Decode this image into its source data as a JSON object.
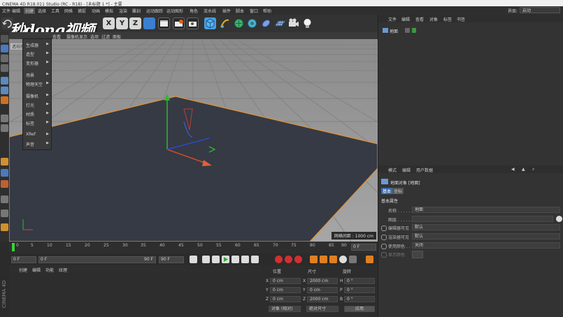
{
  "window": {
    "title": "CINEMA 4D R18.011 Studio (RC - R18) - [未标题 1 *] - 主要"
  },
  "menubar": {
    "items": [
      "文件",
      "编辑",
      "创建",
      "选择",
      "工具",
      "网格",
      "捕捉",
      "动画",
      "模拟",
      "渲染",
      "雕刻",
      "运动跟踪",
      "运动图形",
      "角色",
      "流水线",
      "插件",
      "脚本",
      "窗口",
      "帮助"
    ],
    "layout_label": "界面:",
    "layout_value": "启动"
  },
  "toolbar": {
    "axis_x": "X",
    "axis_y": "Y",
    "axis_z": "Z"
  },
  "watermark": {
    "text": "秒dong视频"
  },
  "viewport": {
    "menu": [
      "查看",
      "摄像机",
      "显示",
      "选项",
      "过滤",
      "面板"
    ],
    "perspective_label": "透视视图",
    "grid_spacing": "网格间距 : 1000 cm"
  },
  "create_menu": {
    "items": [
      {
        "label": "生成器",
        "arrow": true
      },
      {
        "label": "造型",
        "arrow": true
      },
      {
        "label": "变形器",
        "arrow": true
      },
      {
        "label": "场景",
        "arrow": true
      },
      {
        "label": "物理天空",
        "arrow": true
      },
      {
        "label": "摄像机",
        "arrow": true
      },
      {
        "label": "灯光",
        "arrow": true
      },
      {
        "label": "材质",
        "arrow": true
      },
      {
        "label": "标签",
        "arrow": true
      },
      {
        "label": "XRef",
        "arrow": true
      },
      {
        "label": "声音",
        "arrow": true
      }
    ]
  },
  "timeline": {
    "ticks": [
      "0",
      "5",
      "10",
      "15",
      "20",
      "25",
      "30",
      "35",
      "40",
      "45",
      "50",
      "55",
      "60",
      "65",
      "70",
      "75",
      "80",
      "85",
      "90"
    ],
    "end_frame": "0 F"
  },
  "playback": {
    "start": "0 F",
    "slider_start": "0 F",
    "slider_end": "90 F",
    "end": "90 F"
  },
  "object_manager": {
    "menu": [
      "文件",
      "编辑",
      "查看",
      "对象",
      "标签",
      "书签"
    ],
    "objects": [
      {
        "name": "地面"
      }
    ]
  },
  "attribute_manager": {
    "menu": [
      "模式",
      "编辑",
      "用户数据"
    ],
    "object_title": "地面对象 [地面]",
    "tabs": [
      "基本",
      "坐标"
    ],
    "section": "基本属性",
    "rows": [
      {
        "label": "名称 . . . . . .",
        "value": "地面"
      },
      {
        "label": "图层 . . . . . .",
        "value": ""
      },
      {
        "label": "编辑器可见",
        "value": "默认"
      },
      {
        "label": "渲染器可见",
        "value": "默认"
      },
      {
        "label": "使用颜色 . .",
        "value": "关闭"
      },
      {
        "label": "显示颜色",
        "value": ""
      }
    ]
  },
  "material_manager": {
    "menu": [
      "创建",
      "编辑",
      "功能",
      "纹理"
    ]
  },
  "coordinates": {
    "headers": [
      "位置",
      "尺寸",
      "旋转"
    ],
    "rows": [
      {
        "axis": "X",
        "pos": "0 cm",
        "size_axis": "X",
        "size": "2000 cm",
        "rot_axis": "H",
        "rot": "0 °"
      },
      {
        "axis": "Y",
        "pos": "0 cm",
        "size_axis": "Y",
        "size": "0 cm",
        "rot_axis": "P",
        "rot": "0 °"
      },
      {
        "axis": "Z",
        "pos": "0 cm",
        "size_axis": "Z",
        "size": "2000 cm",
        "rot_axis": "B",
        "rot": "0 °"
      }
    ],
    "mode": "对象 (相对)",
    "size_mode": "绝对尺寸",
    "apply": "应用"
  },
  "side_label": "CINEMA 4D"
}
